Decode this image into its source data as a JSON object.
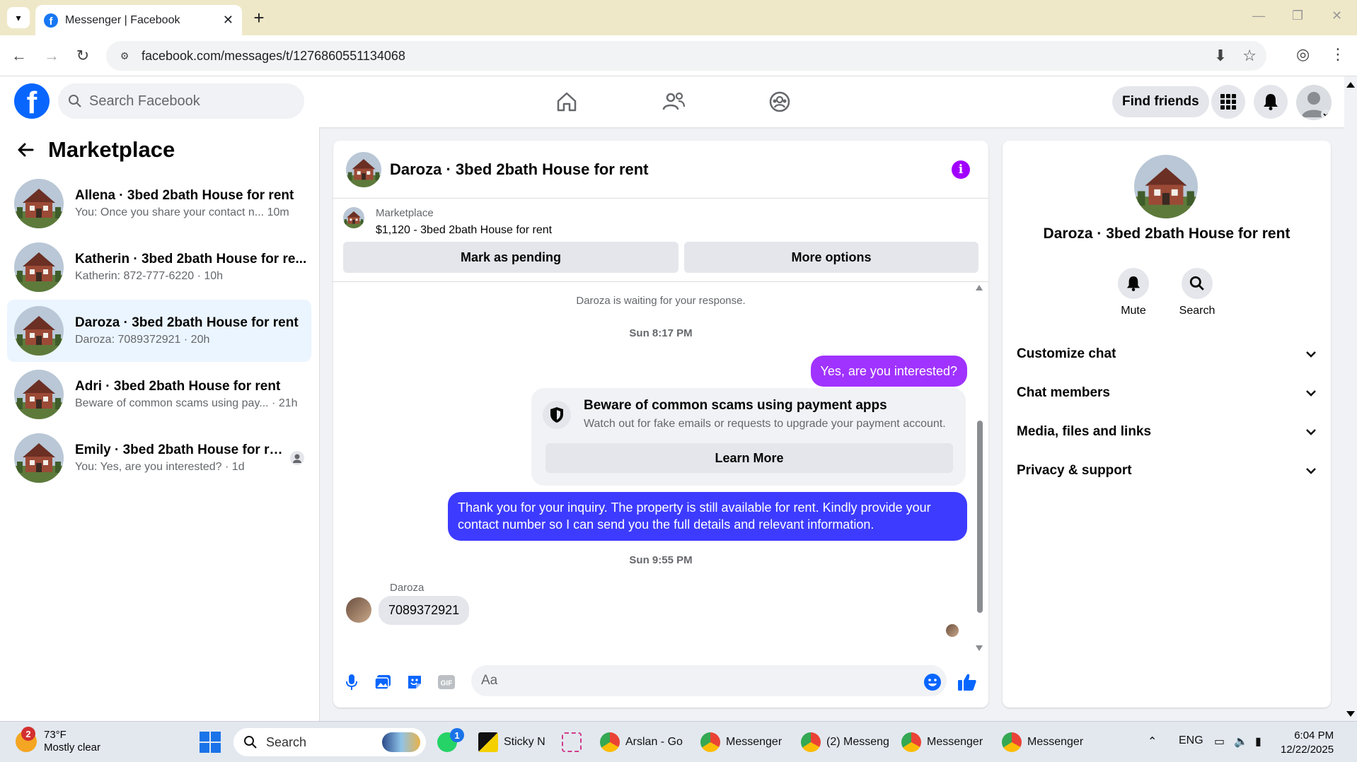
{
  "browser": {
    "tab_title": "Messenger | Facebook",
    "url": "facebook.com/messages/t/1276860551134068"
  },
  "header": {
    "search_placeholder": "Search Facebook",
    "find_friends": "Find friends"
  },
  "sidebar": {
    "title": "Marketplace",
    "conversations": [
      {
        "name": "Allena · 3bed 2bath House for rent",
        "preview": "You: Once you share your contact n...",
        "time": "10m",
        "active": false
      },
      {
        "name": "Katherin · 3bed 2bath House for re...",
        "preview": "Katherin: 872-777-6220",
        "time": "10h",
        "active": false
      },
      {
        "name": "Daroza · 3bed 2bath House for rent",
        "preview": "Daroza: 7089372921",
        "time": "20h",
        "active": true
      },
      {
        "name": "Adri · 3bed 2bath House for rent",
        "preview": "Beware of common scams using pay...",
        "time": "21h",
        "active": false
      },
      {
        "name": "Emily · 3bed 2bath House for rent",
        "preview": "You: Yes, are you interested?",
        "time": "1d",
        "active": false
      }
    ]
  },
  "chat": {
    "title": "Daroza · 3bed 2bath House for rent",
    "marketplace_label": "Marketplace",
    "listing": "$1,120 - 3bed 2bath House for rent",
    "mark_pending": "Mark as pending",
    "more_options": "More options",
    "waiting_note": "Daroza is waiting for your response.",
    "ts1": "Sun 8:17 PM",
    "msg_out_1": "Yes, are you interested?",
    "scam_title": "Beware of common scams using payment apps",
    "scam_sub": "Watch out for fake emails or requests to upgrade your payment account.",
    "learn_more": "Learn More",
    "msg_out_2": "Thank you for your inquiry. The property is still available for rent. Kindly provide your contact number so I can send you the full details and relevant information.",
    "ts2": "Sun 9:55 PM",
    "sender": "Daroza",
    "msg_in_1": "7089372921",
    "composer_placeholder": "Aa"
  },
  "right_panel": {
    "name": "Daroza · 3bed 2bath House for rent",
    "mute": "Mute",
    "search": "Search",
    "rows": [
      "Customize chat",
      "Chat members",
      "Media, files and links",
      "Privacy & support"
    ]
  },
  "taskbar": {
    "weather_badge": "2",
    "temp": "73°F",
    "condition": "Mostly clear",
    "search": "Search",
    "whatsapp_badge": "1",
    "apps": [
      "Sticky N",
      "Arslan - Go",
      "Messenger",
      "(2) Messeng",
      "Messenger",
      "Messenger"
    ],
    "lang": "ENG",
    "time": "6:04 PM",
    "date": "12/22/2025"
  },
  "colors": {
    "fb_blue": "#0866ff",
    "bubble_purple": "#a033ff",
    "bubble_blue": "#3d3bff",
    "active_row": "#ebf5ff"
  }
}
